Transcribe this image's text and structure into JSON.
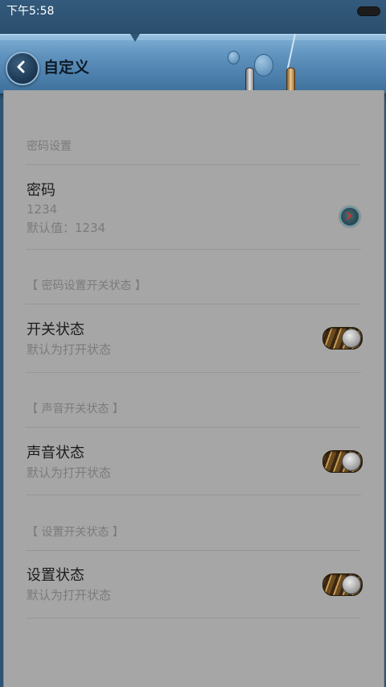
{
  "status_bar": {
    "time": "下午5:58"
  },
  "header": {
    "title": "自定义"
  },
  "sections": [
    {
      "label": "密码设置",
      "row": {
        "title": "密码",
        "value": "1234",
        "default": "默认值：1234",
        "control": "preference-button"
      }
    },
    {
      "label": "【 密码设置开关状态 】",
      "row": {
        "title": "开关状态",
        "summary": "默认为打开状态",
        "control": "toggle",
        "checked": true
      }
    },
    {
      "label": "【 声音开关状态 】",
      "row": {
        "title": "声音状态",
        "summary": "默认为打开状态",
        "control": "toggle",
        "checked": true
      }
    },
    {
      "label": "【 设置开关状态 】",
      "row": {
        "title": "设置状态",
        "summary": "默认为打开状态",
        "control": "toggle",
        "checked": true
      }
    }
  ],
  "colors": {
    "header": "#5f92bd",
    "background": "#a6a6a6",
    "toggle": "#6b4a1e"
  },
  "icons": [
    "back-arrow-icon",
    "chevron-right-icon",
    "battery-icon"
  ]
}
